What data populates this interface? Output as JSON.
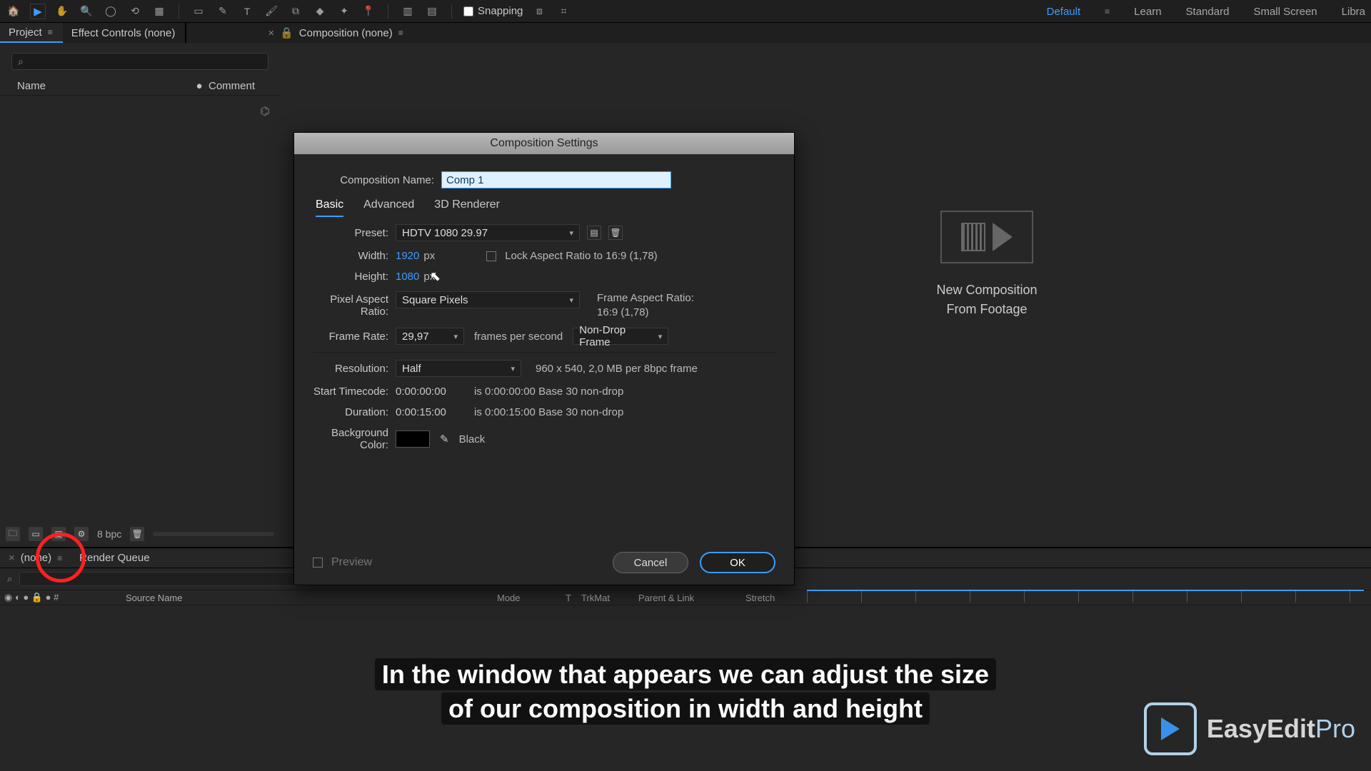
{
  "snapping_label": "Snapping",
  "workspaces": {
    "default": "Default",
    "learn": "Learn",
    "standard": "Standard",
    "small": "Small Screen",
    "libraries": "Libra"
  },
  "panels": {
    "project": "Project",
    "effect_controls": "Effect Controls (none)",
    "composition": "Composition (none)"
  },
  "project_panel": {
    "search_placeholder": "⌕",
    "col_name": "Name",
    "col_tag": "●",
    "col_comment": "Comment",
    "bpc": "8 bpc"
  },
  "new_comp_tile": {
    "line1": "New Composition",
    "line2": "From Footage"
  },
  "timeline": {
    "tab_none": "(none)",
    "tab_render": "Render Queue",
    "col_eye": "◉  ◐  ●  🔒     ●    #",
    "col_source": "Source Name",
    "col_mode": "Mode",
    "col_t": "T",
    "col_trkmat": "TrkMat",
    "col_parent": "Parent & Link",
    "col_stretch": "Stretch"
  },
  "dialog": {
    "title": "Composition Settings",
    "name_label": "Composition Name:",
    "name_value": "Comp 1",
    "tabs": {
      "basic": "Basic",
      "advanced": "Advanced",
      "renderer": "3D Renderer"
    },
    "preset_label": "Preset:",
    "preset_value": "HDTV 1080 29.97",
    "width_label": "Width:",
    "width_value": "1920",
    "px": "px",
    "height_label": "Height:",
    "height_value": "1080",
    "lock_label": "Lock Aspect Ratio to 16:9 (1,78)",
    "par_label": "Pixel Aspect Ratio:",
    "par_value": "Square Pixels",
    "far_label": "Frame Aspect Ratio:",
    "far_value": "16:9 (1,78)",
    "fps_label": "Frame Rate:",
    "fps_value": "29,97",
    "fps_unit": "frames per second",
    "drop_value": "Non-Drop Frame",
    "res_label": "Resolution:",
    "res_value": "Half",
    "res_info": "960 x 540, 2,0 MB per 8bpc frame",
    "start_label": "Start Timecode:",
    "start_value": "0:00:00:00",
    "start_info": "is 0:00:00:00  Base 30  non-drop",
    "dur_label": "Duration:",
    "dur_value": "0:00:15:00",
    "dur_info": "is 0:00:15:00  Base 30  non-drop",
    "bg_label": "Background Color:",
    "bg_name": "Black",
    "preview": "Preview",
    "cancel": "Cancel",
    "ok": "OK"
  },
  "caption": {
    "l1": "In the window that appears we can adjust the size",
    "l2": "of our composition in width and height"
  },
  "brand": {
    "main": "EasyEdit",
    "sub": "Pro"
  },
  "colors": {
    "accent": "#3c9dff",
    "highlight_ring": "#ff2020"
  }
}
